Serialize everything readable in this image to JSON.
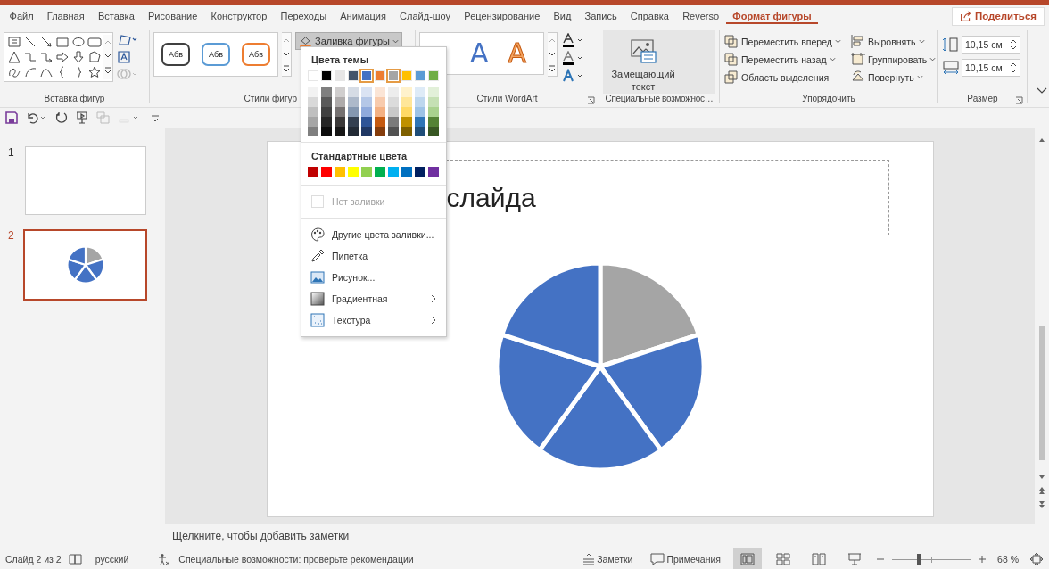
{
  "tabs": [
    {
      "label": "Файл",
      "selected": false
    },
    {
      "label": "Главная",
      "selected": false
    },
    {
      "label": "Вставка",
      "selected": false
    },
    {
      "label": "Рисование",
      "selected": false
    },
    {
      "label": "Конструктор",
      "selected": false
    },
    {
      "label": "Переходы",
      "selected": false
    },
    {
      "label": "Анимация",
      "selected": false
    },
    {
      "label": "Слайд-шоу",
      "selected": false
    },
    {
      "label": "Рецензирование",
      "selected": false
    },
    {
      "label": "Вид",
      "selected": false
    },
    {
      "label": "Запись",
      "selected": false
    },
    {
      "label": "Справка",
      "selected": false
    },
    {
      "label": "Reverso",
      "selected": false
    },
    {
      "label": "Формат фигуры",
      "selected": true
    }
  ],
  "share_button": {
    "label": "Поделиться"
  },
  "ribbon": {
    "insert_shapes": {
      "label": "Вставка фигур"
    },
    "shape_styles": {
      "label": "Стили фигур",
      "styles": [
        {
          "label": "Абв",
          "color": "#404040"
        },
        {
          "label": "Абв",
          "color": "#5b9bd5"
        },
        {
          "label": "Абв",
          "color": "#ed7d31"
        }
      ],
      "fill_button": {
        "label": "Заливка фигуры",
        "expanded": true
      }
    },
    "wordart": {
      "label": "Стили WordArt",
      "styles": [
        {
          "label": "A",
          "color": "#4472c4",
          "kind": "fill"
        },
        {
          "label": "A",
          "color": "#f4a460",
          "kind": "outline"
        }
      ]
    },
    "accessibility": {
      "label": "Специальные возможнос…",
      "button": "Замещающий текст"
    },
    "arrange": {
      "label": "Упорядочить",
      "buttons": [
        {
          "label": "Переместить вперед",
          "kind": "forward",
          "dropdown": true
        },
        {
          "label": "Переместить назад",
          "kind": "backward",
          "dropdown": true
        },
        {
          "label": "Область выделения",
          "kind": "pane",
          "dropdown": false
        },
        {
          "label": "Выровнять",
          "kind": "align",
          "dropdown": true
        },
        {
          "label": "Группировать",
          "kind": "group",
          "dropdown": true
        },
        {
          "label": "Повернуть",
          "kind": "rotate",
          "dropdown": true
        }
      ]
    },
    "size": {
      "label": "Размер",
      "height": "10,15 см",
      "width": "10,15 см"
    }
  },
  "fill_menu": {
    "theme_title": "Цвета темы",
    "theme_colors": [
      {
        "color": "#ffffff",
        "selected": false,
        "shades": [
          {
            "color": "#f2f2f2"
          },
          {
            "color": "#d9d9d9"
          },
          {
            "color": "#bfbfbf"
          },
          {
            "color": "#a6a6a6"
          },
          {
            "color": "#7f7f7f"
          }
        ]
      },
      {
        "color": "#000000",
        "selected": false,
        "shades": [
          {
            "color": "#7f7f7f"
          },
          {
            "color": "#595959"
          },
          {
            "color": "#404040"
          },
          {
            "color": "#262626"
          },
          {
            "color": "#0d0d0d"
          }
        ]
      },
      {
        "color": "#e7e6e6",
        "selected": false,
        "shades": [
          {
            "color": "#d0cece"
          },
          {
            "color": "#aeabab"
          },
          {
            "color": "#757171"
          },
          {
            "color": "#3a3838"
          },
          {
            "color": "#161616"
          }
        ]
      },
      {
        "color": "#44546a",
        "selected": false,
        "shades": [
          {
            "color": "#d6dce5"
          },
          {
            "color": "#adb9ca"
          },
          {
            "color": "#8497b0"
          },
          {
            "color": "#333f50"
          },
          {
            "color": "#222a35"
          }
        ]
      },
      {
        "color": "#4472c4",
        "selected": true,
        "shades": [
          {
            "color": "#dae3f3"
          },
          {
            "color": "#b4c7e7"
          },
          {
            "color": "#8faadc"
          },
          {
            "color": "#2f5597"
          },
          {
            "color": "#203864"
          }
        ]
      },
      {
        "color": "#ed7d31",
        "selected": false,
        "shades": [
          {
            "color": "#fbe5d6"
          },
          {
            "color": "#f8cbad"
          },
          {
            "color": "#f4b183"
          },
          {
            "color": "#c55a11"
          },
          {
            "color": "#843c0c"
          }
        ]
      },
      {
        "color": "#a5a5a5",
        "selected": true,
        "shades": [
          {
            "color": "#ededed"
          },
          {
            "color": "#dbdbdb"
          },
          {
            "color": "#c9c9c9"
          },
          {
            "color": "#7b7b7b"
          },
          {
            "color": "#525252"
          }
        ]
      },
      {
        "color": "#ffc000",
        "selected": false,
        "shades": [
          {
            "color": "#fff2cc"
          },
          {
            "color": "#ffe699"
          },
          {
            "color": "#ffd966"
          },
          {
            "color": "#bf9000"
          },
          {
            "color": "#7f6000"
          }
        ]
      },
      {
        "color": "#5b9bd5",
        "selected": false,
        "shades": [
          {
            "color": "#deebf7"
          },
          {
            "color": "#bdd7ee"
          },
          {
            "color": "#9dc3e6"
          },
          {
            "color": "#2e75b6"
          },
          {
            "color": "#1f4e79"
          }
        ]
      },
      {
        "color": "#70ad47",
        "selected": false,
        "shades": [
          {
            "color": "#e2f0d9"
          },
          {
            "color": "#c5e0b4"
          },
          {
            "color": "#a9d18e"
          },
          {
            "color": "#548235"
          },
          {
            "color": "#385723"
          }
        ]
      }
    ],
    "standard_title": "Стандартные цвета",
    "standard_colors": [
      {
        "color": "#c00000"
      },
      {
        "color": "#ff0000"
      },
      {
        "color": "#ffc000"
      },
      {
        "color": "#ffff00"
      },
      {
        "color": "#92d050"
      },
      {
        "color": "#00b050"
      },
      {
        "color": "#00b0f0"
      },
      {
        "color": "#0070c0"
      },
      {
        "color": "#002060"
      },
      {
        "color": "#7030a0"
      }
    ],
    "items": [
      {
        "label": "Нет заливки",
        "kind": "none",
        "disabled": true,
        "submenu": false
      },
      {
        "label": "Другие цвета заливки...",
        "kind": "more",
        "disabled": false,
        "submenu": false
      },
      {
        "label": "Пипетка",
        "kind": "eyedropper",
        "disabled": false,
        "submenu": false
      },
      {
        "label": "Рисунок...",
        "kind": "picture",
        "disabled": false,
        "submenu": false
      },
      {
        "label": "Градиентная",
        "kind": "gradient",
        "disabled": false,
        "submenu": true
      },
      {
        "label": "Текстура",
        "kind": "texture",
        "disabled": false,
        "submenu": true
      }
    ]
  },
  "slides": [
    {
      "number": "1",
      "selected": false,
      "kind": "blank"
    },
    {
      "number": "2",
      "selected": true,
      "kind": "pie"
    }
  ],
  "slide": {
    "title": "слайда",
    "pie": {
      "slices": [
        {
          "color": "#a5a5a5"
        },
        {
          "color": "#4472c4"
        },
        {
          "color": "#4472c4"
        },
        {
          "color": "#4472c4"
        },
        {
          "color": "#4472c4"
        }
      ]
    }
  },
  "notes_placeholder": "Щелкните, чтобы добавить заметки",
  "status_bar": {
    "slide": "Слайд 2 из 2",
    "language": "русский",
    "accessibility": "Специальные возможности: проверьте рекомендации",
    "notes": "Заметки",
    "comments": "Примечания",
    "views": [
      {
        "kind": "normal",
        "selected": true
      },
      {
        "kind": "sorter",
        "selected": false
      },
      {
        "kind": "reading",
        "selected": false
      },
      {
        "kind": "show",
        "selected": false
      }
    ],
    "zoom": {
      "level": 0.34,
      "reading": "68 %"
    }
  }
}
